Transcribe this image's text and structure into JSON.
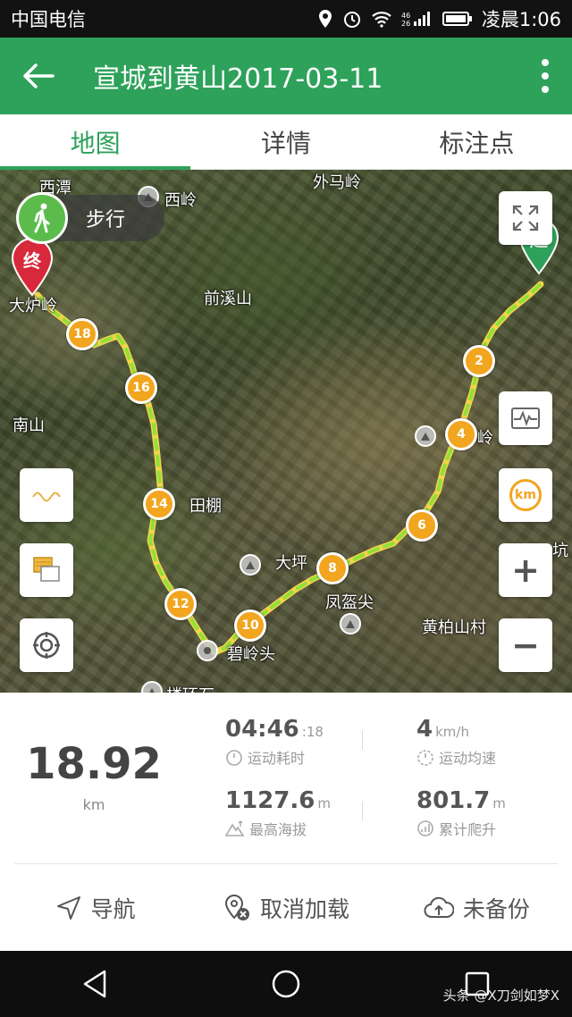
{
  "status_bar": {
    "carrier": "中国电信",
    "time": "凌晨1:06",
    "signal_text": "46 26"
  },
  "app_bar": {
    "title": "宣城到黄山2017-03-11",
    "back_icon": "arrow-left-icon",
    "menu_icon": "more-vertical-icon"
  },
  "tabs": [
    {
      "label": "地图",
      "active": true
    },
    {
      "label": "详情",
      "active": false
    },
    {
      "label": "标注点",
      "active": false
    }
  ],
  "map": {
    "mode": {
      "label": "步行",
      "icon": "walking-icon"
    },
    "place_labels": [
      "西潭",
      "西岭",
      "外马岭",
      "大炉岭",
      "前溪山",
      "南山",
      "田棚",
      "大坪",
      "凤盔尖",
      "碧岭头",
      "黄柏山村",
      "岭",
      "楼环石",
      "坑"
    ],
    "start_marker": "起",
    "end_marker": "终",
    "km_markers": [
      "2",
      "4",
      "6",
      "8",
      "10",
      "12",
      "14",
      "16",
      "18"
    ],
    "route_color": "#8fe03a",
    "buttons": {
      "fullscreen_icon": "fullscreen-icon",
      "altitude_chart_icon": "heartbeat-chart-icon",
      "km_label": "km",
      "zoom_in": "+",
      "zoom_out": "−",
      "speed_chart_icon": "wave-line-icon",
      "layers_icon": "layers-icon",
      "locate_icon": "locate-target-icon"
    }
  },
  "stats": {
    "distance": {
      "value": "18.92",
      "unit": "km"
    },
    "duration": {
      "value": "04:46",
      "seconds": ":18",
      "label": "运动耗时"
    },
    "speed": {
      "value": "4",
      "unit": "km/h",
      "label": "运动均速"
    },
    "max_altitude": {
      "value": "1127.6",
      "unit": "m",
      "label": "最高海拔"
    },
    "total_climb": {
      "value": "801.7",
      "unit": "m",
      "label": "累计爬升"
    }
  },
  "actions": [
    {
      "label": "导航",
      "icon": "navigation-arrow-icon"
    },
    {
      "label": "取消加载",
      "icon": "location-cancel-icon"
    },
    {
      "label": "未备份",
      "icon": "cloud-upload-icon"
    }
  ],
  "watermark": "头条 @X刀剑如梦X",
  "colors": {
    "accent": "#2ea15a",
    "marker": "#f2a51e",
    "end_pin": "#d8283b",
    "start_pin": "#2ea15a"
  }
}
